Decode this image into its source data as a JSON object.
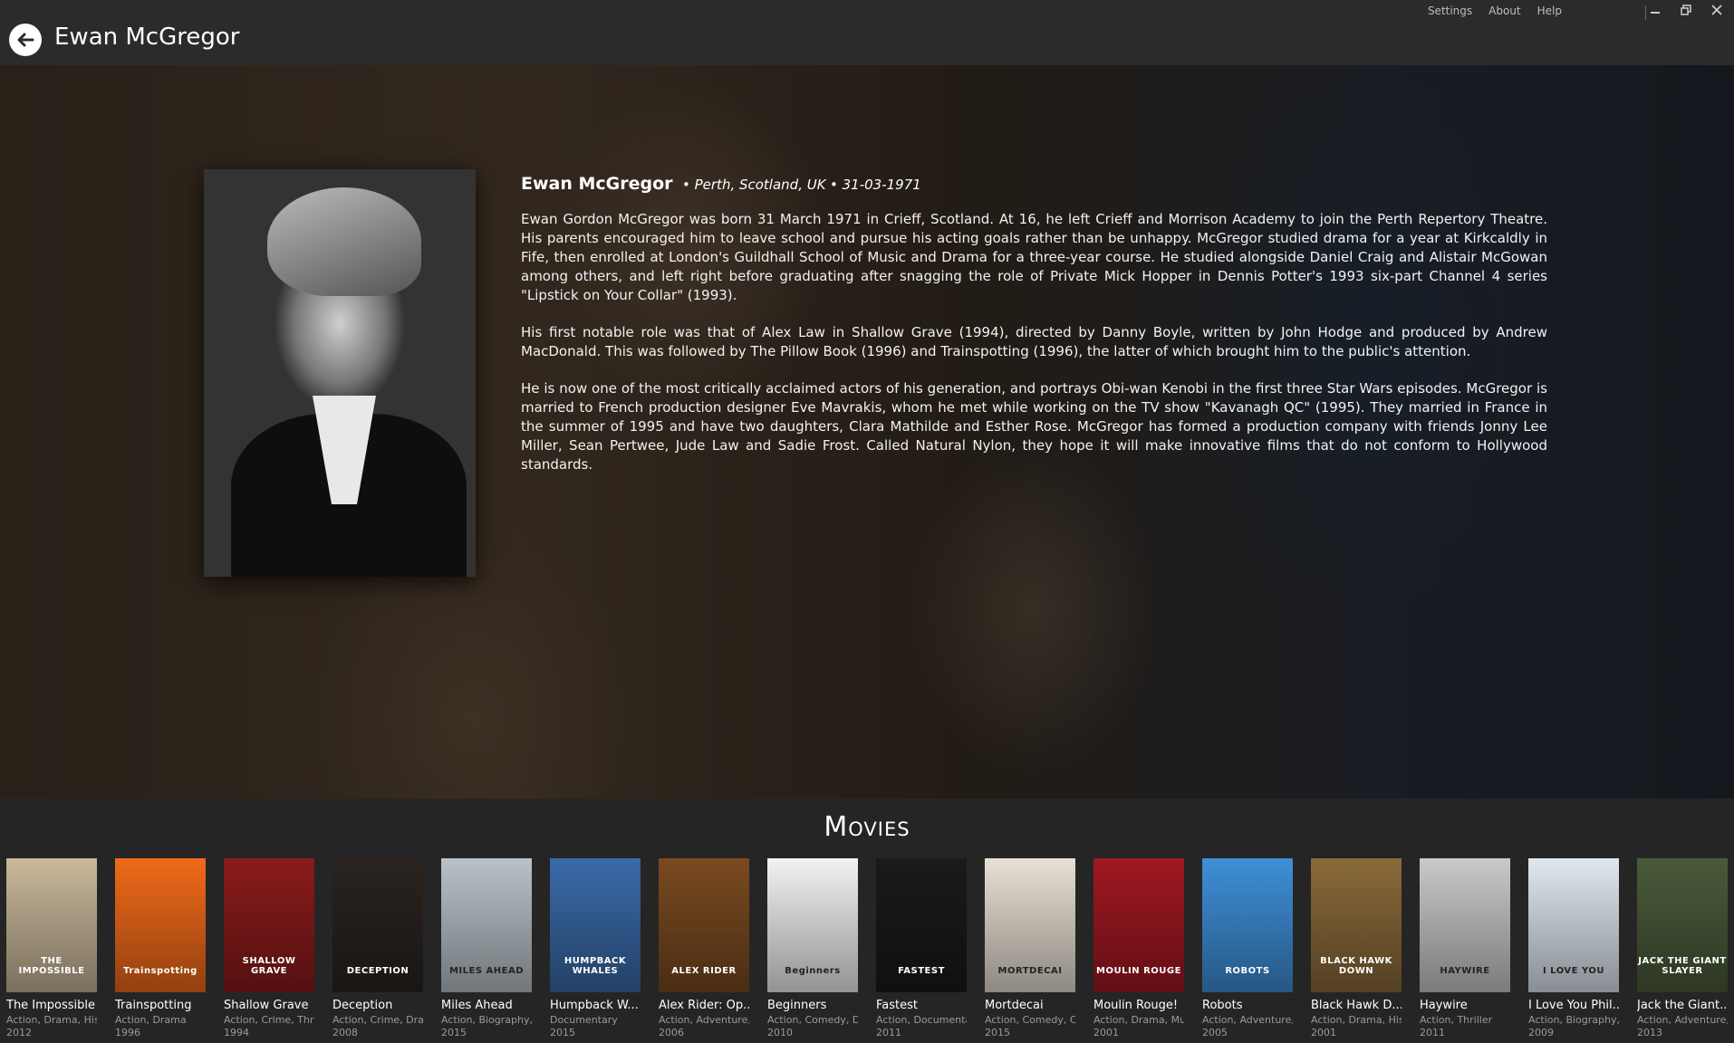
{
  "window": {
    "title": "Ewan McGregor",
    "links": [
      "Settings",
      "About",
      "Help"
    ]
  },
  "bio": {
    "name": "Ewan McGregor",
    "birthplace": "• Perth, Scotland, UK",
    "birthdate": "• 31-03-1971",
    "paragraphs": [
      "Ewan Gordon McGregor was born 31 March 1971 in Crieff, Scotland. At 16, he left Crieff and Morrison Academy to join the Perth Repertory Theatre. His parents encouraged him to leave school and pursue his acting goals rather than be unhappy. McGregor studied drama for a year at Kirkcaldly in Fife, then enrolled at London's Guildhall School of Music and Drama for a three-year course. He studied alongside Daniel Craig and Alistair McGowan among others, and left right before graduating after snagging the role of Private Mick Hopper in Dennis Potter's 1993 six-part Channel 4 series \"Lipstick on Your Collar\" (1993).",
      "His first notable role was that of Alex Law in Shallow Grave (1994), directed by Danny Boyle, written by John Hodge and produced by Andrew MacDonald. This was followed by The Pillow Book (1996) and Trainspotting (1996), the latter of which brought him to the public's attention.",
      "He is now one of the most critically acclaimed actors of his generation, and portrays Obi-wan Kenobi in the first three Star Wars episodes. McGregor is married to French production designer Eve Mavrakis, whom he met while working on the TV show \"Kavanagh QC\" (1995). They married in France in the summer of 1995 and have two daughters, Clara Mathilde and Esther Rose. McGregor has formed a production company with friends Jonny Lee Miller, Sean Pertwee, Jude Law and Sadie Frost. Called Natural Nylon, they hope it will make innovative films that do not conform to Hollywood standards."
    ]
  },
  "movies": {
    "heading": "Movies",
    "items": [
      {
        "title": "The Impossible",
        "genre": "Action, Drama, Hist",
        "year": "2012",
        "poster_text": "THE IMPOSSIBLE",
        "color": "#c9b89a"
      },
      {
        "title": "Trainspotting",
        "genre": "Action, Drama",
        "year": "1996",
        "poster_text": "Trainspotting",
        "color": "#f06a1a"
      },
      {
        "title": "Shallow Grave",
        "genre": "Action, Crime, Thril",
        "year": "1994",
        "poster_text": "SHALLOW GRAVE",
        "color": "#8a1b1b"
      },
      {
        "title": "Deception",
        "genre": "Action, Crime, Drar",
        "year": "2008",
        "poster_text": "DECEPTION",
        "color": "#2a2420"
      },
      {
        "title": "Miles Ahead",
        "genre": "Action, Biography,",
        "year": "2015",
        "poster_text": "MILES AHEAD",
        "color": "#b9c2c8"
      },
      {
        "title": "Humpback W...",
        "genre": "Documentary",
        "year": "2015",
        "poster_text": "HUMPBACK WHALES",
        "color": "#3a6aa8"
      },
      {
        "title": "Alex Rider: Op...",
        "genre": "Action, Adventure,",
        "year": "2006",
        "poster_text": "ALEX RIDER",
        "color": "#7a4a20"
      },
      {
        "title": "Beginners",
        "genre": "Action, Comedy, Dr",
        "year": "2010",
        "poster_text": "Beginners",
        "color": "#f2f2f2"
      },
      {
        "title": "Fastest",
        "genre": "Action, Documenta",
        "year": "2011",
        "poster_text": "FASTEST",
        "color": "#1a1a1a"
      },
      {
        "title": "Mortdecai",
        "genre": "Action, Comedy, Cr",
        "year": "2015",
        "poster_text": "MORTDECAI",
        "color": "#e8e0d4"
      },
      {
        "title": "Moulin Rouge!",
        "genre": "Action, Drama, Mu",
        "year": "2001",
        "poster_text": "MOULIN ROUGE",
        "color": "#a01822"
      },
      {
        "title": "Robots",
        "genre": "Action, Adventure,",
        "year": "2005",
        "poster_text": "ROBOTS",
        "color": "#3f8fd8"
      },
      {
        "title": "Black Hawk D...",
        "genre": "Action, Drama, Hist",
        "year": "2001",
        "poster_text": "BLACK HAWK DOWN",
        "color": "#8a6a3a"
      },
      {
        "title": "Haywire",
        "genre": "Action, Thriller",
        "year": "2011",
        "poster_text": "HAYWIRE",
        "color": "#c9c9c9"
      },
      {
        "title": "I Love You Phil...",
        "genre": "Action, Biography,",
        "year": "2009",
        "poster_text": "I LOVE YOU",
        "color": "#dfe8f0"
      },
      {
        "title": "Jack the Giant...",
        "genre": "Action, Adventure,",
        "year": "2013",
        "poster_text": "JACK THE GIANT SLAYER",
        "color": "#4a5a3a"
      }
    ]
  }
}
